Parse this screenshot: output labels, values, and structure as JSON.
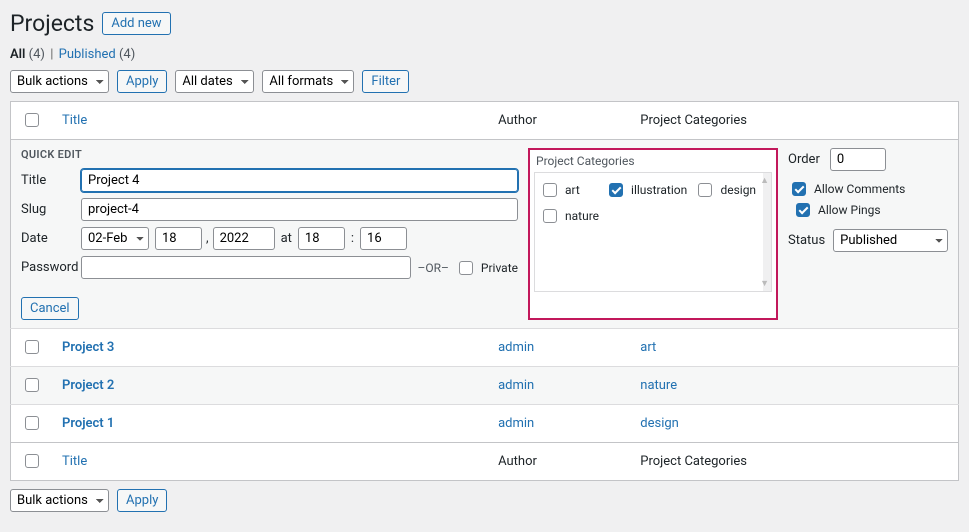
{
  "page": {
    "title": "Projects",
    "add_new": "Add new"
  },
  "filters": {
    "all_label": "All",
    "all_count": "(4)",
    "published_label": "Published",
    "published_count": "(4)"
  },
  "toolbar": {
    "bulk_actions": "Bulk actions",
    "apply": "Apply",
    "all_dates": "All dates",
    "all_formats": "All formats",
    "filter": "Filter"
  },
  "columns": {
    "title": "Title",
    "author": "Author",
    "cats": "Project Categories"
  },
  "quick_edit": {
    "heading": "QUICK EDIT",
    "labels": {
      "title": "Title",
      "slug": "Slug",
      "date": "Date",
      "password": "Password",
      "or": "–OR–",
      "private": "Private"
    },
    "title_value": "Project 4",
    "slug_value": "project-4",
    "month": "02-Feb",
    "day": "18",
    "year": "2022",
    "at": "at",
    "hour": "18",
    "minute": "16",
    "cats_heading": "Project Categories",
    "cats": [
      {
        "label": "art",
        "checked": false,
        "child": false
      },
      {
        "label": "illustration",
        "checked": true,
        "child": true
      },
      {
        "label": "design",
        "checked": false,
        "child": false
      },
      {
        "label": "nature",
        "checked": false,
        "child": false
      }
    ],
    "right": {
      "order_label": "Order",
      "order_value": "0",
      "allow_comments": "Allow Comments",
      "allow_pings": "Allow Pings",
      "status_label": "Status",
      "status_value": "Published"
    },
    "cancel": "Cancel"
  },
  "rows": [
    {
      "title": "Project 3",
      "author": "admin",
      "cat": "art"
    },
    {
      "title": "Project 2",
      "author": "admin",
      "cat": "nature"
    },
    {
      "title": "Project 1",
      "author": "admin",
      "cat": "design"
    }
  ]
}
